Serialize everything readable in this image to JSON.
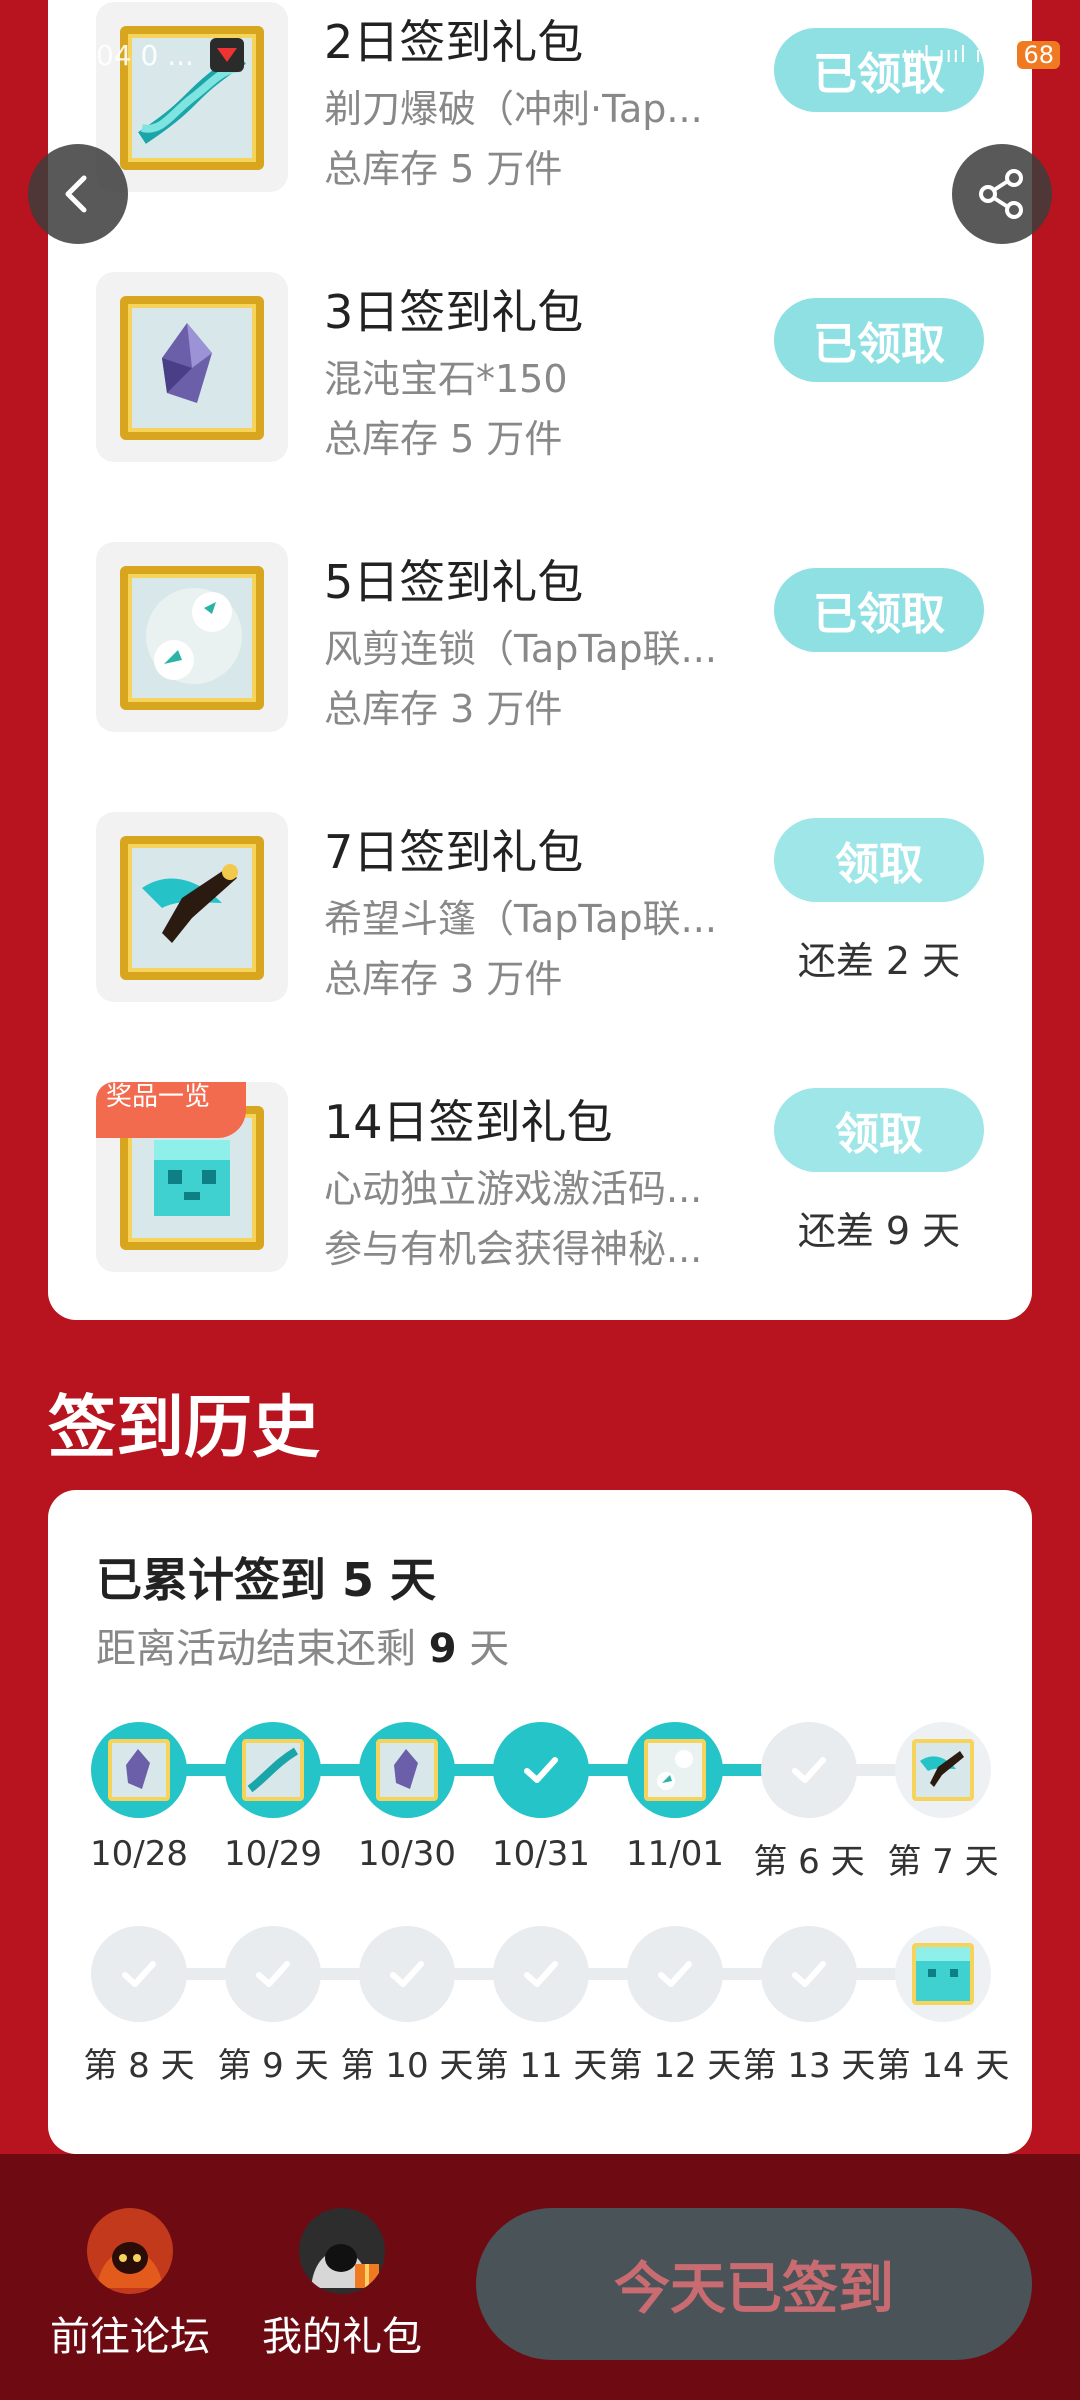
{
  "status_bar": {
    "time": "04 0 ...",
    "signal": "ıııl ıııl ıııl",
    "battery": "68"
  },
  "rewards": [
    {
      "title": "2日签到礼包",
      "subtitle": "剃刀爆破（冲刺·Tap...",
      "stock": "总库存 5 万件",
      "button": "已领取",
      "state": "claimed",
      "icon": "dna-helix-icon"
    },
    {
      "title": "3日签到礼包",
      "subtitle": "混沌宝石*150",
      "stock": "总库存 5 万件",
      "button": "已领取",
      "state": "claimed",
      "icon": "crystal-gem-icon"
    },
    {
      "title": "5日签到礼包",
      "subtitle": "风剪连锁（TapTap联...",
      "stock": "总库存 3 万件",
      "button": "已领取",
      "state": "claimed",
      "icon": "wind-orb-icon"
    },
    {
      "title": "7日签到礼包",
      "subtitle": "希望斗篷（TapTap联...",
      "stock": "总库存 3 万件",
      "button": "领取",
      "state": "locked",
      "remaining": "还差 2 天",
      "icon": "cape-icon"
    },
    {
      "title": "14日签到礼包",
      "subtitle": "心动独立游戏激活码...",
      "stock": "参与有机会获得神秘...",
      "button": "领取",
      "state": "locked",
      "remaining": "还差 9 天",
      "badge": "奖品一览",
      "icon": "mystery-cube-icon"
    }
  ],
  "history": {
    "heading": "签到历史",
    "total_prefix": "已累计签到 ",
    "total_days": "5",
    "total_suffix": " 天",
    "remain_prefix": "距离活动结束还剩 ",
    "remain_days": "9",
    "remain_suffix": " 天",
    "row1": [
      {
        "label": "10/28",
        "state": "done",
        "icon": "crystal-gem-icon"
      },
      {
        "label": "10/29",
        "state": "done",
        "icon": "dna-helix-icon"
      },
      {
        "label": "10/30",
        "state": "done",
        "icon": "crystal-gem-icon"
      },
      {
        "label": "10/31",
        "state": "done",
        "icon": "check-icon"
      },
      {
        "label": "11/01",
        "state": "done",
        "icon": "wind-orb-icon"
      },
      {
        "label": "第 6 天",
        "state": "pending",
        "icon": "check-icon"
      },
      {
        "label": "第 7 天",
        "state": "gift",
        "icon": "cape-icon"
      }
    ],
    "row2": [
      {
        "label": "第 8 天",
        "state": "pending",
        "icon": "check-icon"
      },
      {
        "label": "第 9 天",
        "state": "pending",
        "icon": "check-icon"
      },
      {
        "label": "第 10 天",
        "state": "pending",
        "icon": "check-icon"
      },
      {
        "label": "第 11 天",
        "state": "pending",
        "icon": "check-icon"
      },
      {
        "label": "第 12 天",
        "state": "pending",
        "icon": "check-icon"
      },
      {
        "label": "第 13 天",
        "state": "pending",
        "icon": "check-icon"
      },
      {
        "label": "第 14 天",
        "state": "gift",
        "icon": "mystery-cube-icon"
      }
    ]
  },
  "bottom": {
    "forum_label": "前往论坛",
    "gifts_label": "我的礼包",
    "checked_label": "今天已签到"
  },
  "colors": {
    "page_bg": "#b8141f",
    "accent_teal": "#24c4c9",
    "claimed_btn": "#8fe0e3",
    "bottom_bar": "#6e0b12"
  }
}
